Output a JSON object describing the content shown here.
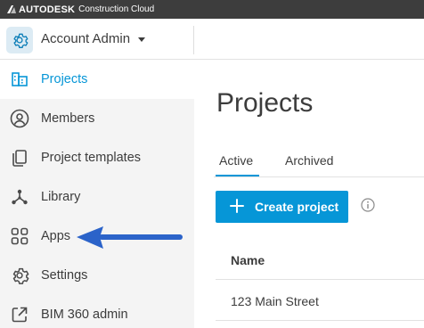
{
  "topbar": {
    "brand": "AUTODESK",
    "product": "Construction Cloud"
  },
  "account": {
    "title": "Account Admin"
  },
  "sidebar": {
    "items": [
      {
        "label": "Projects",
        "icon": "building-icon",
        "active": true
      },
      {
        "label": "Members",
        "icon": "person-circle-icon",
        "active": false
      },
      {
        "label": "Project templates",
        "icon": "copy-document-icon",
        "active": false
      },
      {
        "label": "Library",
        "icon": "network-icon",
        "active": false
      },
      {
        "label": "Apps",
        "icon": "grid-four-icon",
        "active": false
      },
      {
        "label": "Settings",
        "icon": "gear-icon",
        "active": false
      },
      {
        "label": "BIM 360 admin",
        "icon": "external-link-icon",
        "active": false
      }
    ]
  },
  "main": {
    "title": "Projects",
    "tabs": [
      {
        "label": "Active",
        "active": true
      },
      {
        "label": "Archived",
        "active": false
      }
    ],
    "create_button": "Create project",
    "table": {
      "headers": [
        "Name"
      ],
      "rows": [
        [
          "123 Main Street"
        ]
      ]
    }
  },
  "colors": {
    "accent": "#0696d7",
    "topbar": "#3d3d3d",
    "annotation_arrow": "#2b63c9"
  }
}
